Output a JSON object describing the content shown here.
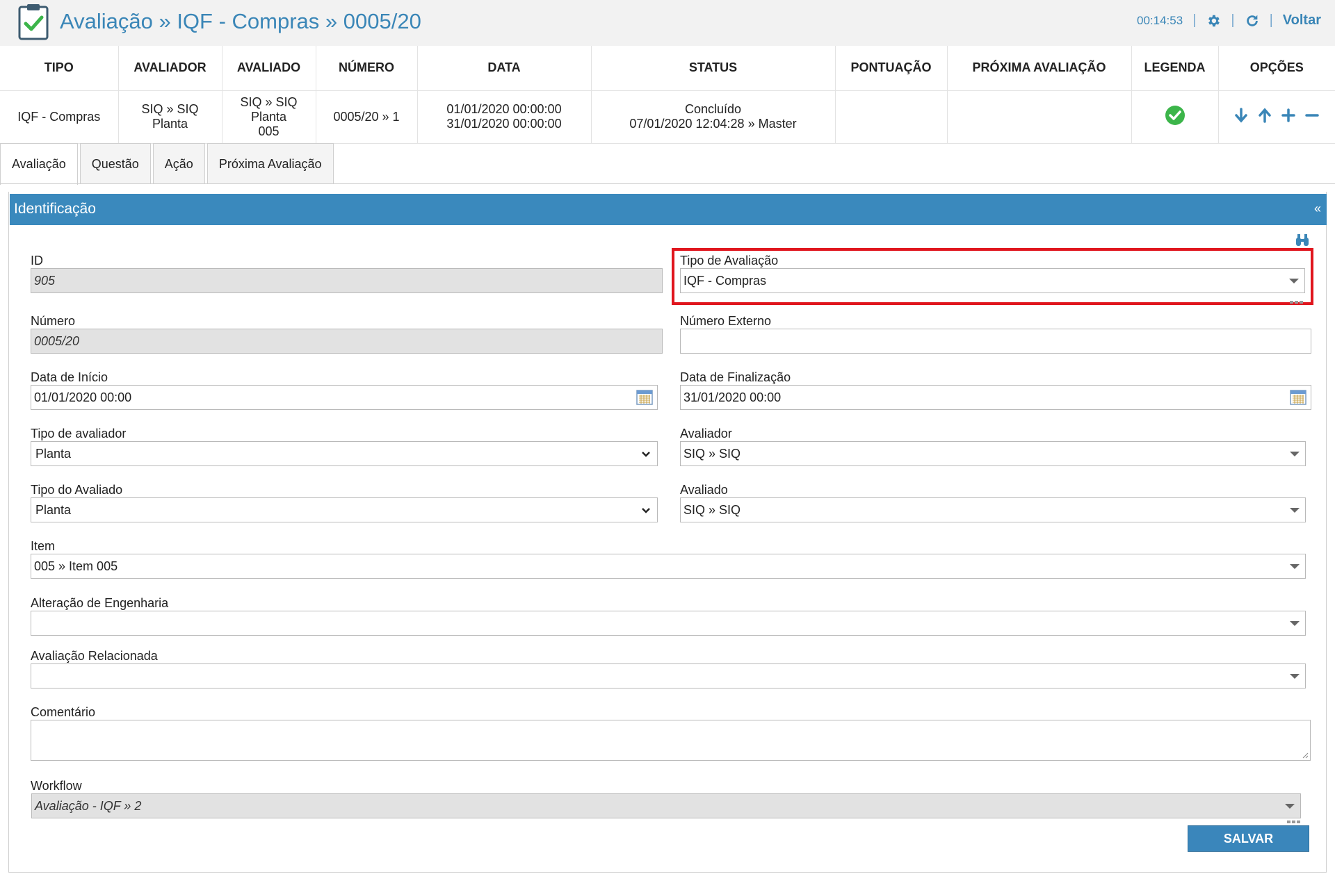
{
  "header": {
    "title": "Avaliação » IQF - Compras » 0005/20",
    "timer": "00:14:53",
    "back_label": "Voltar"
  },
  "summary": {
    "columns": [
      "TIPO",
      "AVALIADOR",
      "AVALIADO",
      "NÚMERO",
      "DATA",
      "STATUS",
      "PONTUAÇÃO",
      "PRÓXIMA AVALIAÇÃO",
      "LEGENDA",
      "OPÇÕES"
    ],
    "row": {
      "tipo": "IQF - Compras",
      "avaliador": [
        "SIQ » SIQ",
        "Planta"
      ],
      "avaliado": [
        "SIQ » SIQ",
        "Planta",
        "005"
      ],
      "numero": "0005/20 » 1",
      "data": [
        "01/01/2020 00:00:00",
        "31/01/2020 00:00:00"
      ],
      "status": [
        "Concluído",
        "07/01/2020 12:04:28 » Master"
      ],
      "pontuacao": "",
      "proxima": ""
    }
  },
  "tabs": [
    "Avaliação",
    "Questão",
    "Ação",
    "Próxima Avaliação"
  ],
  "panel": {
    "title": "Identificação",
    "collapse": "«"
  },
  "form": {
    "id_label": "ID",
    "id_value": "905",
    "tipo_avaliacao_label": "Tipo de Avaliação",
    "tipo_avaliacao_value": "IQF - Compras",
    "numero_label": "Número",
    "numero_value": "0005/20",
    "numero_externo_label": "Número Externo",
    "numero_externo_value": "",
    "data_inicio_label": "Data de Início",
    "data_inicio_value": "01/01/2020 00:00",
    "data_fim_label": "Data de Finalização",
    "data_fim_value": "31/01/2020 00:00",
    "tipo_avaliador_label": "Tipo de avaliador",
    "tipo_avaliador_value": "Planta",
    "avaliador_label": "Avaliador",
    "avaliador_value": "SIQ » SIQ",
    "tipo_avaliado_label": "Tipo do Avaliado",
    "tipo_avaliado_value": "Planta",
    "avaliado_label": "Avaliado",
    "avaliado_value": "SIQ » SIQ",
    "item_label": "Item",
    "item_value": "005 » Item 005",
    "alteracao_label": "Alteração de Engenharia",
    "alteracao_value": "",
    "relacionada_label": "Avaliação Relacionada",
    "relacionada_value": "",
    "comentario_label": "Comentário",
    "workflow_label": "Workflow",
    "workflow_value": "Avaliação - IQF » 2",
    "save_label": "SALVAR"
  },
  "colors": {
    "accent": "#3a86b7",
    "panel_header": "#3a89bd",
    "highlight": "#e0161e",
    "legend_ok": "#3cb54a"
  },
  "icons": [
    "clipboard-check-icon",
    "gear-icon",
    "refresh-icon",
    "check-circle-icon",
    "arrow-down-icon",
    "arrow-up-icon",
    "plus-icon",
    "minus-icon",
    "calendar-icon",
    "binoculars-icon",
    "chevron-down-icon",
    "caret-down-icon"
  ]
}
